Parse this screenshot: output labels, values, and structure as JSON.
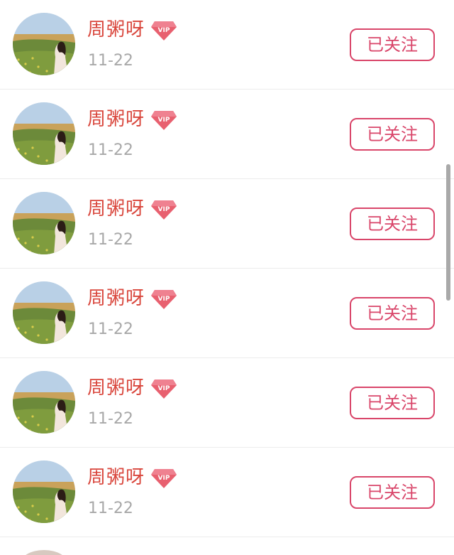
{
  "follow_list": [
    {
      "name": "周粥呀",
      "date": "11-22",
      "button_label": "已关注",
      "badge": "VIP"
    },
    {
      "name": "周粥呀",
      "date": "11-22",
      "button_label": "已关注",
      "badge": "VIP"
    },
    {
      "name": "周粥呀",
      "date": "11-22",
      "button_label": "已关注",
      "badge": "VIP"
    },
    {
      "name": "周粥呀",
      "date": "11-22",
      "button_label": "已关注",
      "badge": "VIP"
    },
    {
      "name": "周粥呀",
      "date": "11-22",
      "button_label": "已关注",
      "badge": "VIP"
    },
    {
      "name": "周粥呀",
      "date": "11-22",
      "button_label": "已关注",
      "badge": "VIP"
    }
  ],
  "icons": {
    "avatar": "avatar-landscape-girl-icon",
    "badge": "vip-diamond-icon"
  },
  "colors": {
    "name_text": "#d9463c",
    "date_text": "#a8a8a8",
    "button_border": "#d9466a",
    "vip_badge": "#e8606f",
    "divider": "#ececec"
  }
}
